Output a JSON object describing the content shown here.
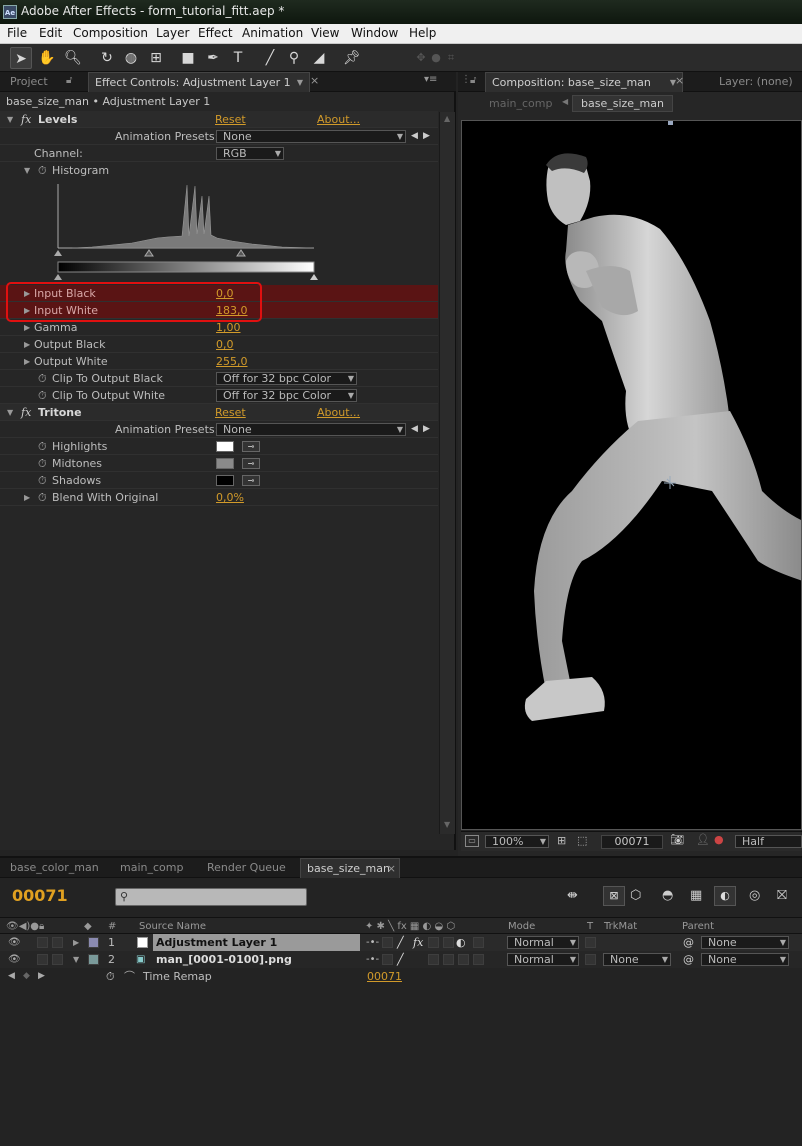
{
  "window": {
    "title": "Adobe After Effects - form_tutorial_fitt.aep *",
    "app_badge": "Ae"
  },
  "menu": [
    "File",
    "Edit",
    "Composition",
    "Layer",
    "Effect",
    "Animation",
    "View",
    "Window",
    "Help"
  ],
  "effect_panel": {
    "tabs": {
      "project": "Project",
      "effect_controls": "Effect Controls: Adjustment Layer 1"
    },
    "breadcrumb": "base_size_man • Adjustment Layer 1",
    "levels": {
      "name": "Levels",
      "reset": "Reset",
      "about": "About...",
      "presets_label": "Animation Presets:",
      "presets_value": "None",
      "channel_label": "Channel:",
      "channel_value": "RGB",
      "histogram_label": "Histogram",
      "input_black_label": "Input Black",
      "input_black": "0,0",
      "input_white_label": "Input White",
      "input_white": "183,0",
      "gamma_label": "Gamma",
      "gamma": "1,00",
      "output_black_label": "Output Black",
      "output_black": "0,0",
      "output_white_label": "Output White",
      "output_white": "255,0",
      "clip_black_label": "Clip To Output Black",
      "clip_black": "Off for 32 bpc Color",
      "clip_white_label": "Clip To Output White",
      "clip_white": "Off for 32 bpc Color"
    },
    "tritone": {
      "name": "Tritone",
      "reset": "Reset",
      "about": "About...",
      "presets_label": "Animation Presets:",
      "presets_value": "None",
      "highlights_label": "Highlights",
      "midtones_label": "Midtones",
      "shadows_label": "Shadows",
      "blend_label": "Blend With Original",
      "blend": "0,0%",
      "colors": {
        "highlights": "#ffffff",
        "midtones": "#8a8a8a",
        "shadows": "#000000"
      }
    }
  },
  "comp_panel": {
    "tab": "Composition: base_size_man",
    "layer_tab": "Layer: (none)",
    "nav": {
      "main_comp": "main_comp",
      "base_size_man": "base_size_man"
    },
    "footer": {
      "zoom": "100%",
      "timecode": "00071",
      "resolution": "Half"
    }
  },
  "timeline": {
    "tabs": [
      "base_color_man",
      "main_comp",
      "Render Queue",
      "base_size_man"
    ],
    "timecode": "00071",
    "columns": {
      "num": "#",
      "source": "Source Name",
      "mode": "Mode",
      "t": "T",
      "trkmat": "TrkMat",
      "parent": "Parent"
    },
    "layers": [
      {
        "num": "1",
        "name": "Adjustment Layer 1",
        "mode": "Normal",
        "trkmat": "",
        "parent": "None",
        "label_color": "#8a8ab0"
      },
      {
        "num": "2",
        "name": "man_[0001-0100].png",
        "mode": "Normal",
        "trkmat": "None",
        "parent": "None",
        "label_color": "#7a9a9a"
      }
    ],
    "time_remap_label": "Time Remap",
    "time_remap_value": "00071"
  }
}
